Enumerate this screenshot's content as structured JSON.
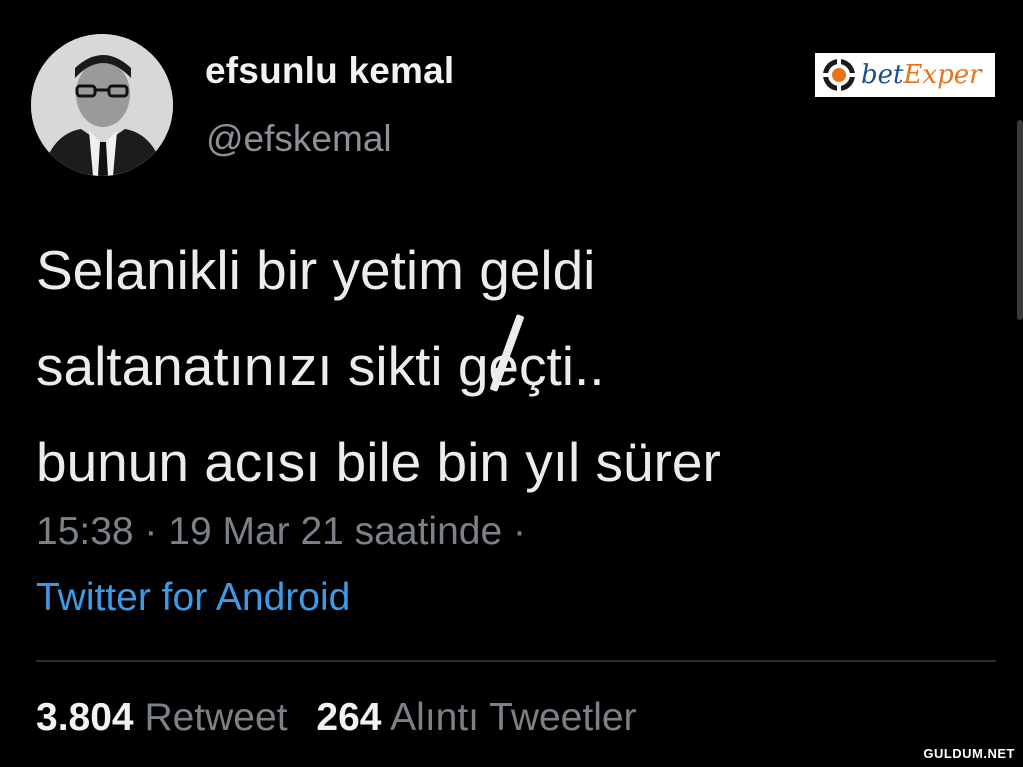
{
  "profile": {
    "display_name": "efsunlu kemal",
    "handle": "@efskemal"
  },
  "tweet": {
    "lines": [
      "Selanikli bir yetim geldi",
      "saltanatınızı sikti geçti..",
      "bunun acısı bile bin yıl sürer"
    ],
    "meta": "15:38 · 19 Mar 21 saatinde ·",
    "source": "Twitter for Android"
  },
  "stats": {
    "retweet_count": "3.804",
    "retweet_label": "Retweet",
    "quote_count": "264",
    "quote_label": "Alıntı Tweetler"
  },
  "logo": {
    "part1": "bet",
    "part2": "Exper"
  },
  "watermark": "GULDUM.NET",
  "colors": {
    "background": "#000000",
    "link": "#3f9ae6",
    "muted": "#7b8187",
    "text": "#ececec"
  }
}
